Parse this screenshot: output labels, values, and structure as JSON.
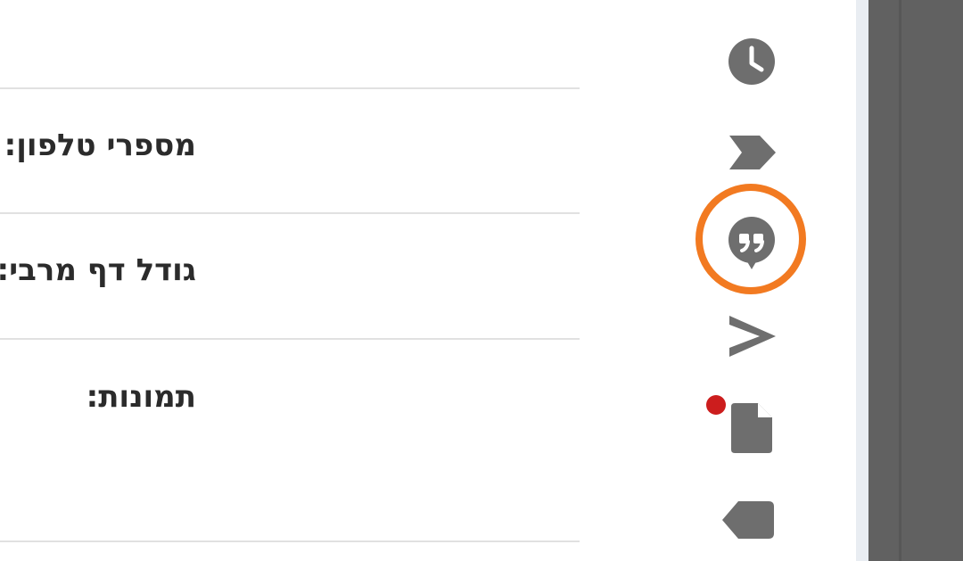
{
  "settings": {
    "rows": [
      {
        "label": "מספרי טלפון:"
      },
      {
        "label": "גודל דף מרבי:"
      },
      {
        "label": "תמונות:"
      }
    ]
  },
  "icon_rail": {
    "icons": [
      "clock-icon",
      "label-arrow-icon",
      "quote-bubble-icon",
      "send-icon",
      "document-icon",
      "tag-icon"
    ],
    "highlighted": "quote-bubble-icon",
    "notification_on": "document-icon"
  },
  "colors": {
    "icon_gray": "#6e6e6e",
    "highlight_orange": "#f27a21",
    "notification_red": "#cc1d1d",
    "dark_panel": "#616161"
  }
}
